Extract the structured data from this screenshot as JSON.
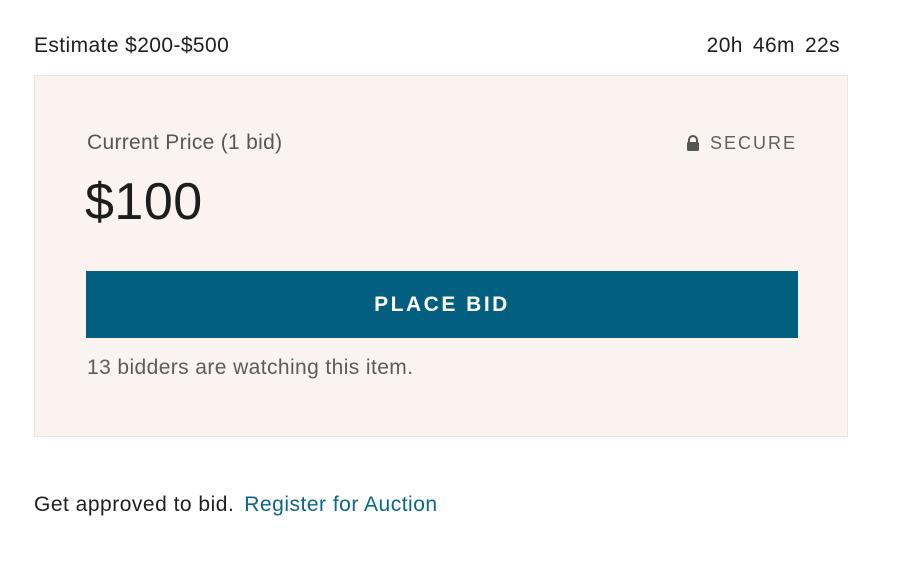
{
  "estimate": {
    "label": "Estimate $200-$500"
  },
  "countdown": {
    "hours": "20h",
    "minutes": "46m",
    "seconds": "22s"
  },
  "bid_panel": {
    "price_label": "Current Price (1 bid)",
    "secure_label": "SECURE",
    "lock_icon": "lock-icon",
    "current_price": "$100",
    "place_bid_label": "PLACE BID",
    "watchers_text": "13 bidders are watching this item."
  },
  "registration": {
    "prompt": "Get approved to bid.",
    "link_text": "Register for Auction"
  },
  "colors": {
    "panel_background": "#faf3f0",
    "button_background": "#025f7f",
    "link_color": "#0b6784"
  }
}
